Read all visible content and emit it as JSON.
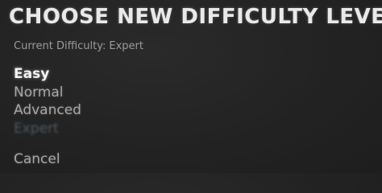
{
  "dialog": {
    "title": "CHOOSE NEW DIFFICULTY LEVEL",
    "current_label": "Current Difficulty:",
    "current_value": "Expert"
  },
  "options": [
    {
      "label": "Easy",
      "state": "selected"
    },
    {
      "label": "Normal",
      "state": "normal"
    },
    {
      "label": "Advanced",
      "state": "normal"
    },
    {
      "label": "Expert",
      "state": "disabled"
    }
  ],
  "cancel_label": "Cancel",
  "colors": {
    "background": "#232323",
    "title": "#e9e9e9",
    "selected": "#f4f4f4",
    "normal": "#a7a7a7",
    "disabled": "#4e5963",
    "subtext": "#9b9b9b"
  }
}
